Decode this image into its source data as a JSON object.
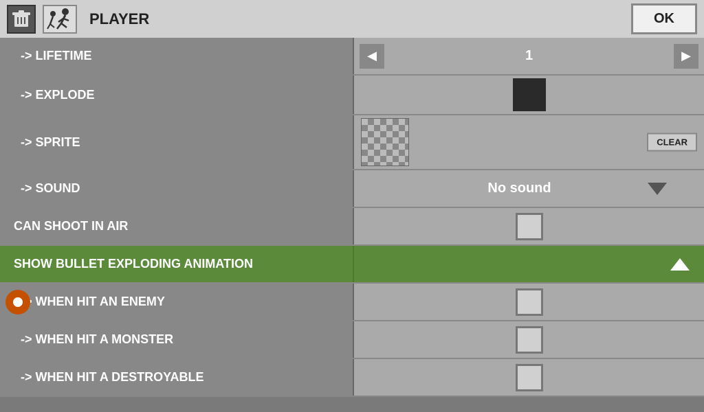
{
  "header": {
    "title": "PLAYER",
    "ok_label": "OK"
  },
  "rows": [
    {
      "id": "lifetime",
      "label": "-> LIFETIME",
      "type": "stepper",
      "value": "1",
      "indented": true
    },
    {
      "id": "explode",
      "label": "-> EXPLODE",
      "type": "color-swatch",
      "indented": true
    },
    {
      "id": "sprite",
      "label": "-> SPRITE",
      "type": "sprite",
      "clear_label": "CLEAR",
      "indented": true
    },
    {
      "id": "sound",
      "label": "-> SOUND",
      "type": "dropdown",
      "value": "No sound",
      "indented": true
    },
    {
      "id": "can-shoot-in-air",
      "label": "CAN SHOOT IN AIR",
      "type": "checkbox",
      "indented": false
    },
    {
      "id": "show-bullet",
      "label": "SHOW BULLET EXPLODING ANIMATION",
      "type": "section-header",
      "indented": false
    },
    {
      "id": "when-hit-enemy",
      "label": "-> WHEN HIT AN ENEMY",
      "type": "checkbox",
      "indented": true
    },
    {
      "id": "when-hit-monster",
      "label": "-> WHEN HIT A MONSTER",
      "type": "checkbox",
      "indented": true
    },
    {
      "id": "when-hit-destroyable",
      "label": "-> WHEN HIT A DESTROYABLE",
      "type": "checkbox",
      "indented": true
    }
  ]
}
